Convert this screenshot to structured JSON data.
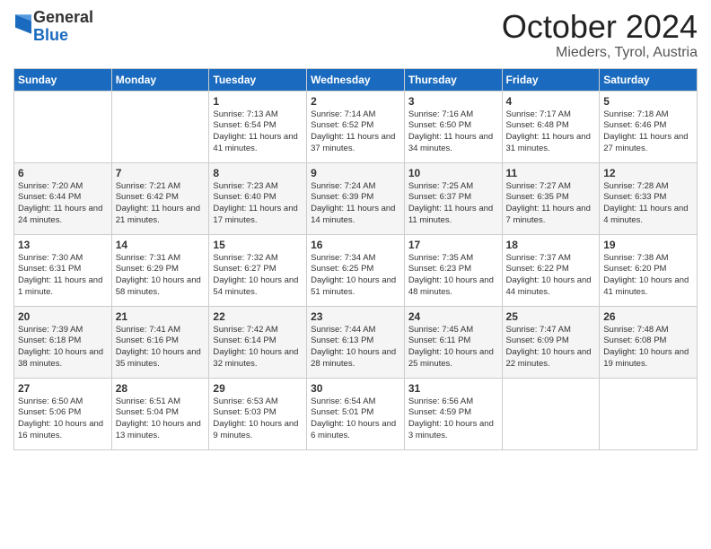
{
  "header": {
    "logo_general": "General",
    "logo_blue": "Blue",
    "month_title": "October 2024",
    "location": "Mieders, Tyrol, Austria"
  },
  "days_of_week": [
    "Sunday",
    "Monday",
    "Tuesday",
    "Wednesday",
    "Thursday",
    "Friday",
    "Saturday"
  ],
  "weeks": [
    [
      {
        "day": "",
        "info": ""
      },
      {
        "day": "",
        "info": ""
      },
      {
        "day": "1",
        "info": "Sunrise: 7:13 AM\nSunset: 6:54 PM\nDaylight: 11 hours and 41 minutes."
      },
      {
        "day": "2",
        "info": "Sunrise: 7:14 AM\nSunset: 6:52 PM\nDaylight: 11 hours and 37 minutes."
      },
      {
        "day": "3",
        "info": "Sunrise: 7:16 AM\nSunset: 6:50 PM\nDaylight: 11 hours and 34 minutes."
      },
      {
        "day": "4",
        "info": "Sunrise: 7:17 AM\nSunset: 6:48 PM\nDaylight: 11 hours and 31 minutes."
      },
      {
        "day": "5",
        "info": "Sunrise: 7:18 AM\nSunset: 6:46 PM\nDaylight: 11 hours and 27 minutes."
      }
    ],
    [
      {
        "day": "6",
        "info": "Sunrise: 7:20 AM\nSunset: 6:44 PM\nDaylight: 11 hours and 24 minutes."
      },
      {
        "day": "7",
        "info": "Sunrise: 7:21 AM\nSunset: 6:42 PM\nDaylight: 11 hours and 21 minutes."
      },
      {
        "day": "8",
        "info": "Sunrise: 7:23 AM\nSunset: 6:40 PM\nDaylight: 11 hours and 17 minutes."
      },
      {
        "day": "9",
        "info": "Sunrise: 7:24 AM\nSunset: 6:39 PM\nDaylight: 11 hours and 14 minutes."
      },
      {
        "day": "10",
        "info": "Sunrise: 7:25 AM\nSunset: 6:37 PM\nDaylight: 11 hours and 11 minutes."
      },
      {
        "day": "11",
        "info": "Sunrise: 7:27 AM\nSunset: 6:35 PM\nDaylight: 11 hours and 7 minutes."
      },
      {
        "day": "12",
        "info": "Sunrise: 7:28 AM\nSunset: 6:33 PM\nDaylight: 11 hours and 4 minutes."
      }
    ],
    [
      {
        "day": "13",
        "info": "Sunrise: 7:30 AM\nSunset: 6:31 PM\nDaylight: 11 hours and 1 minute."
      },
      {
        "day": "14",
        "info": "Sunrise: 7:31 AM\nSunset: 6:29 PM\nDaylight: 10 hours and 58 minutes."
      },
      {
        "day": "15",
        "info": "Sunrise: 7:32 AM\nSunset: 6:27 PM\nDaylight: 10 hours and 54 minutes."
      },
      {
        "day": "16",
        "info": "Sunrise: 7:34 AM\nSunset: 6:25 PM\nDaylight: 10 hours and 51 minutes."
      },
      {
        "day": "17",
        "info": "Sunrise: 7:35 AM\nSunset: 6:23 PM\nDaylight: 10 hours and 48 minutes."
      },
      {
        "day": "18",
        "info": "Sunrise: 7:37 AM\nSunset: 6:22 PM\nDaylight: 10 hours and 44 minutes."
      },
      {
        "day": "19",
        "info": "Sunrise: 7:38 AM\nSunset: 6:20 PM\nDaylight: 10 hours and 41 minutes."
      }
    ],
    [
      {
        "day": "20",
        "info": "Sunrise: 7:39 AM\nSunset: 6:18 PM\nDaylight: 10 hours and 38 minutes."
      },
      {
        "day": "21",
        "info": "Sunrise: 7:41 AM\nSunset: 6:16 PM\nDaylight: 10 hours and 35 minutes."
      },
      {
        "day": "22",
        "info": "Sunrise: 7:42 AM\nSunset: 6:14 PM\nDaylight: 10 hours and 32 minutes."
      },
      {
        "day": "23",
        "info": "Sunrise: 7:44 AM\nSunset: 6:13 PM\nDaylight: 10 hours and 28 minutes."
      },
      {
        "day": "24",
        "info": "Sunrise: 7:45 AM\nSunset: 6:11 PM\nDaylight: 10 hours and 25 minutes."
      },
      {
        "day": "25",
        "info": "Sunrise: 7:47 AM\nSunset: 6:09 PM\nDaylight: 10 hours and 22 minutes."
      },
      {
        "day": "26",
        "info": "Sunrise: 7:48 AM\nSunset: 6:08 PM\nDaylight: 10 hours and 19 minutes."
      }
    ],
    [
      {
        "day": "27",
        "info": "Sunrise: 6:50 AM\nSunset: 5:06 PM\nDaylight: 10 hours and 16 minutes."
      },
      {
        "day": "28",
        "info": "Sunrise: 6:51 AM\nSunset: 5:04 PM\nDaylight: 10 hours and 13 minutes."
      },
      {
        "day": "29",
        "info": "Sunrise: 6:53 AM\nSunset: 5:03 PM\nDaylight: 10 hours and 9 minutes."
      },
      {
        "day": "30",
        "info": "Sunrise: 6:54 AM\nSunset: 5:01 PM\nDaylight: 10 hours and 6 minutes."
      },
      {
        "day": "31",
        "info": "Sunrise: 6:56 AM\nSunset: 4:59 PM\nDaylight: 10 hours and 3 minutes."
      },
      {
        "day": "",
        "info": ""
      },
      {
        "day": "",
        "info": ""
      }
    ]
  ]
}
